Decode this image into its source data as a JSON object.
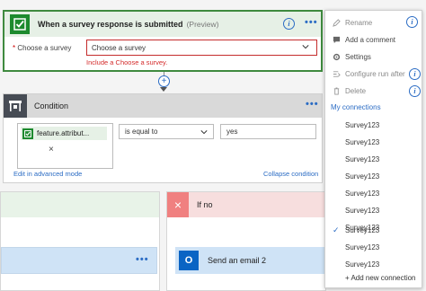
{
  "trigger": {
    "title": "When a survey response is submitted",
    "preview": "(Preview)",
    "field_label": "Choose a survey",
    "required_mark": "*",
    "select_value": "Choose a survey",
    "error": "Include a Choose a survey.",
    "dots": "•••",
    "info": "i"
  },
  "condition": {
    "title": "Condition",
    "token": "feature.attribut...",
    "token_remove": "×",
    "operator": "is equal to",
    "value": "yes",
    "edit_advanced": "Edit in advanced mode",
    "collapse": "Collapse condition",
    "dots": "•••"
  },
  "connector": {
    "plus": "+"
  },
  "branch_yes": {
    "dots": "•••"
  },
  "branch_no": {
    "title": "If no",
    "close": "×",
    "action_title": "Send an email 2",
    "outlook_letter": "O"
  },
  "menu": {
    "items": [
      {
        "label": "Rename",
        "icon": "rename-icon",
        "disabled": true
      },
      {
        "label": "Add a comment",
        "icon": "comment-icon",
        "disabled": false
      },
      {
        "label": "Settings",
        "icon": "settings-icon",
        "disabled": false
      },
      {
        "label": "Configure run after",
        "icon": "configure-run-after-icon",
        "disabled": true
      },
      {
        "label": "Delete",
        "icon": "delete-icon",
        "disabled": true
      }
    ],
    "connections_heading": "My connections",
    "connections": [
      {
        "label": "Survey123",
        "checked": false
      },
      {
        "label": "Survey123",
        "checked": false
      },
      {
        "label": "Survey123",
        "checked": false
      },
      {
        "label": "Survey123",
        "checked": false
      },
      {
        "label": "Survey123",
        "checked": false
      },
      {
        "label": "Survey123",
        "checked": false
      },
      {
        "label": "Survey123",
        "checked": false
      },
      {
        "label": "Survey123",
        "checked": true
      },
      {
        "label": "Survey123",
        "checked": false
      },
      {
        "label": "Survey123",
        "checked": false
      }
    ],
    "add_connection": "+ Add new connection",
    "info": "i",
    "check": "✓"
  },
  "colors": {
    "accent": "#2b6cc4",
    "survey_green": "#1d8a2e",
    "error_red": "#d42b2b",
    "condition_dark": "#474c55",
    "if_no_red": "#f08080",
    "outlook_blue": "#0a64c4"
  }
}
